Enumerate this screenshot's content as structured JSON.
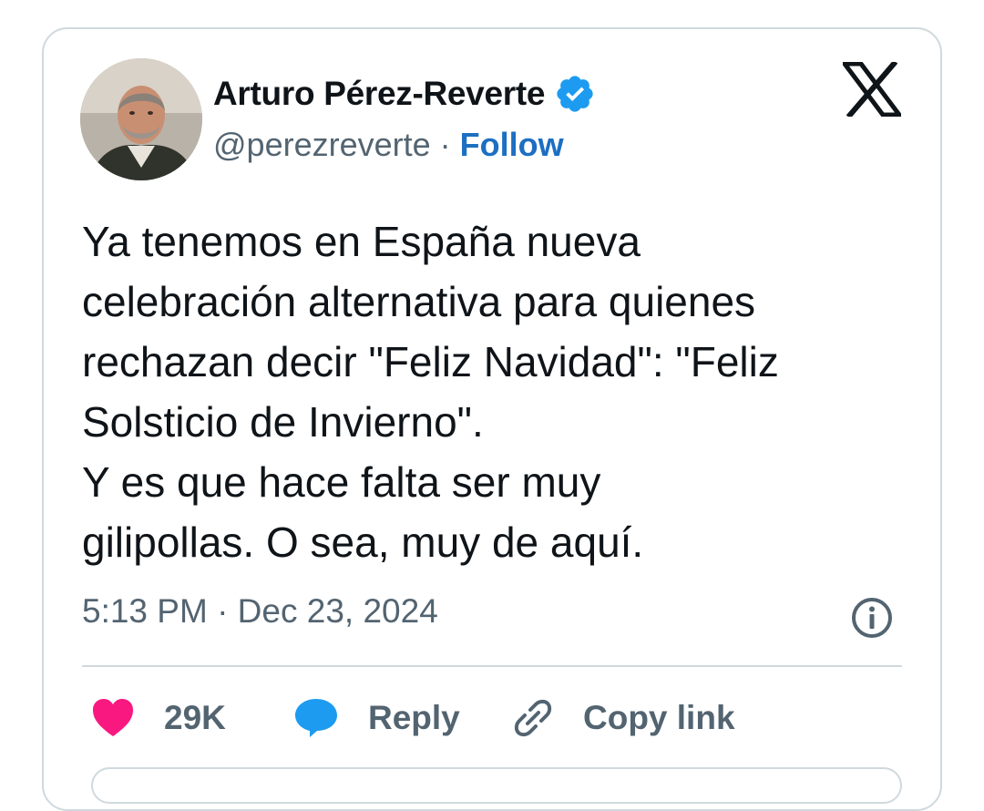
{
  "author": {
    "name": "Arturo Pérez-Reverte",
    "handle": "@perezreverte",
    "separator": "·",
    "follow_label": "Follow",
    "verified_color": "#1d9bf0"
  },
  "brand": {
    "logo_icon": "x-logo-icon"
  },
  "tweet": {
    "lines": [
      "Ya tenemos en España nueva",
      "celebración alternativa para quienes",
      "rechazan decir \"Feliz Navidad\": \"Feliz",
      "Solsticio de Invierno\".",
      "Y es que hace falta ser muy",
      "gilipollas. O sea, muy de aquí."
    ],
    "timestamp": "5:13 PM · Dec 23, 2024"
  },
  "actions": {
    "like_count": "29K",
    "like_color": "#f91880",
    "reply_label": "Reply",
    "reply_color": "#1d9bf0",
    "copy_link_label": "Copy link"
  }
}
